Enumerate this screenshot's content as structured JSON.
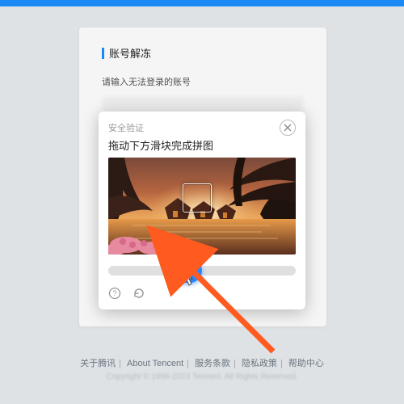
{
  "card": {
    "title": "账号解冻",
    "hint": "请输入无法登录的账号"
  },
  "captcha": {
    "header": "安全验证",
    "instruction": "拖动下方滑块完成拼图"
  },
  "footer": {
    "links": [
      "关于腾讯",
      "About Tencent",
      "服务条款",
      "隐私政策",
      "帮助中心"
    ],
    "copyright": "Copyright © 1998-2023 Tencent. All Rights Reserved."
  }
}
